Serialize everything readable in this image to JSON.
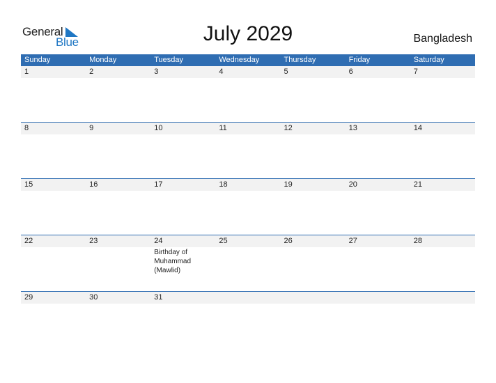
{
  "logo": {
    "part1": "General",
    "part2": "Blue"
  },
  "header": {
    "title": "July 2029",
    "country": "Bangladesh"
  },
  "colors": {
    "accent": "#2f6db2",
    "logo_blue": "#1f77c4",
    "day_row_bg": "#f2f2f2"
  },
  "weekdays": [
    "Sunday",
    "Monday",
    "Tuesday",
    "Wednesday",
    "Thursday",
    "Friday",
    "Saturday"
  ],
  "weeks": [
    {
      "days": [
        "1",
        "2",
        "3",
        "4",
        "5",
        "6",
        "7"
      ],
      "events": [
        "",
        "",
        "",
        "",
        "",
        "",
        ""
      ]
    },
    {
      "days": [
        "8",
        "9",
        "10",
        "11",
        "12",
        "13",
        "14"
      ],
      "events": [
        "",
        "",
        "",
        "",
        "",
        "",
        ""
      ]
    },
    {
      "days": [
        "15",
        "16",
        "17",
        "18",
        "19",
        "20",
        "21"
      ],
      "events": [
        "",
        "",
        "",
        "",
        "",
        "",
        ""
      ]
    },
    {
      "days": [
        "22",
        "23",
        "24",
        "25",
        "26",
        "27",
        "28"
      ],
      "events": [
        "",
        "",
        "Birthday of Muhammad (Mawlid)",
        "",
        "",
        "",
        ""
      ]
    },
    {
      "days": [
        "29",
        "30",
        "31",
        "",
        "",
        "",
        ""
      ],
      "events": [
        "",
        "",
        "",
        "",
        "",
        "",
        ""
      ]
    }
  ]
}
